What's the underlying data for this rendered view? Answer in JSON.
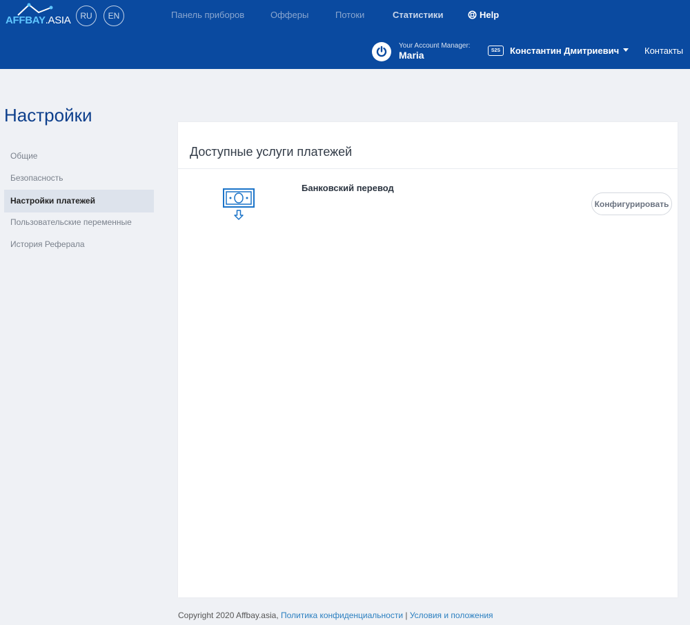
{
  "header": {
    "logo_main": "AFFBAY",
    "logo_suffix": ".ASIA",
    "languages": [
      "RU",
      "EN"
    ],
    "nav": [
      "Панель приборов",
      "Офферы",
      "Потоки",
      "Статистики"
    ],
    "help_label": "Help",
    "account_manager_caption": "Your Account Manager:",
    "account_manager_name": "Maria",
    "s2s_badge": "S2S",
    "user_name": "Константин Дмитриевич",
    "contacts_label": "Контакты"
  },
  "sidebar": {
    "title": "Настройки",
    "items": [
      {
        "label": "Общие",
        "active": false
      },
      {
        "label": "Безопасность",
        "active": false
      },
      {
        "label": "Настройки платежей",
        "active": true
      },
      {
        "label": "Пользовательские переменные",
        "active": false
      },
      {
        "label": "История Реферала",
        "active": false
      }
    ]
  },
  "main": {
    "card_title": "Доступные услуги платежей",
    "services": [
      {
        "name": "Банковский перевод",
        "icon": "bank-transfer-icon",
        "button_label": "Конфигурировать"
      }
    ]
  },
  "footer": {
    "copyright": "Copyright 2020 Affbay.asia, ",
    "privacy_link": "Политика конфиденциальности",
    "separator": " | ",
    "terms_link": "Условия и положения"
  },
  "colors": {
    "header_bg": "#0a4aa0",
    "page_bg": "#eff1f5",
    "accent_blue": "#1a73c8",
    "title_blue": "#0d3f8c",
    "link_blue": "#2a7fc0"
  }
}
